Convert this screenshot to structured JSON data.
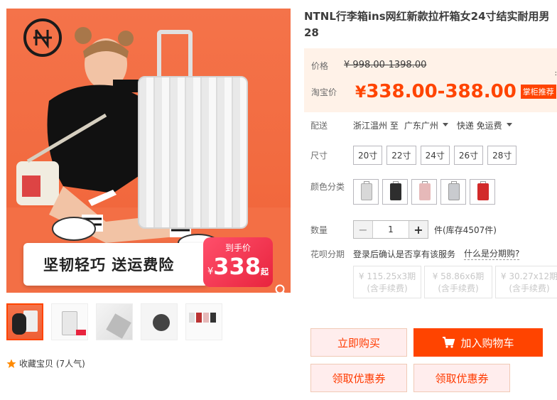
{
  "product": {
    "title": "NTNL行李箱ins网红新款拉杆箱女24寸结实耐用男28"
  },
  "gallery": {
    "promo_text": "坚韧轻巧 送运费险",
    "tag_label": "到手价",
    "tag_currency": "¥",
    "tag_price": "338",
    "tag_suffix": "起",
    "logo_icon": "ntnl-logo",
    "thumbnails": [
      "thumb-1",
      "thumb-2",
      "thumb-3",
      "thumb-4",
      "thumb-5"
    ]
  },
  "favorite": {
    "label": "收藏宝贝 (7人气)"
  },
  "price": {
    "original_label": "价格",
    "original_value": "¥ 998.00-1398.00",
    "tb_label": "淘宝价",
    "currency": "¥",
    "tb_value": "338.00-388.00",
    "badge": "掌柜推荐"
  },
  "shipping": {
    "label": "配送",
    "from": "浙江温州 至",
    "to": "广东广州",
    "method": "快递 免运费"
  },
  "sizes": {
    "label": "尺寸",
    "options": [
      "20寸",
      "22寸",
      "24寸",
      "26寸",
      "28寸"
    ]
  },
  "colors": {
    "label": "颜色分类",
    "swatches": [
      "#d8d8d8",
      "#2e2e2e",
      "#e6b9b9",
      "#c9cbcf",
      "#d22a2a"
    ]
  },
  "quantity": {
    "label": "数量",
    "value": "1",
    "stock": "件(库存4507件)"
  },
  "huabei": {
    "label": "花呗分期",
    "notice": "登录后确认是否享有该服务",
    "link": "什么是分期购?"
  },
  "installments": [
    {
      "price": "¥ 115.25x3期",
      "fee": "(含手续费)"
    },
    {
      "price": "¥ 58.86x6期",
      "fee": "(含手续费)"
    },
    {
      "price": "¥ 30.27x12期",
      "fee": "(含手续费)"
    }
  ],
  "actions": {
    "buy_now": "立即购买",
    "add_cart": "加入购物车",
    "coupon1": "领取优惠券",
    "coupon2": "领取优惠券"
  },
  "colors_theme": {
    "accent": "#ff4400",
    "price_bg": "#fff2e8"
  }
}
